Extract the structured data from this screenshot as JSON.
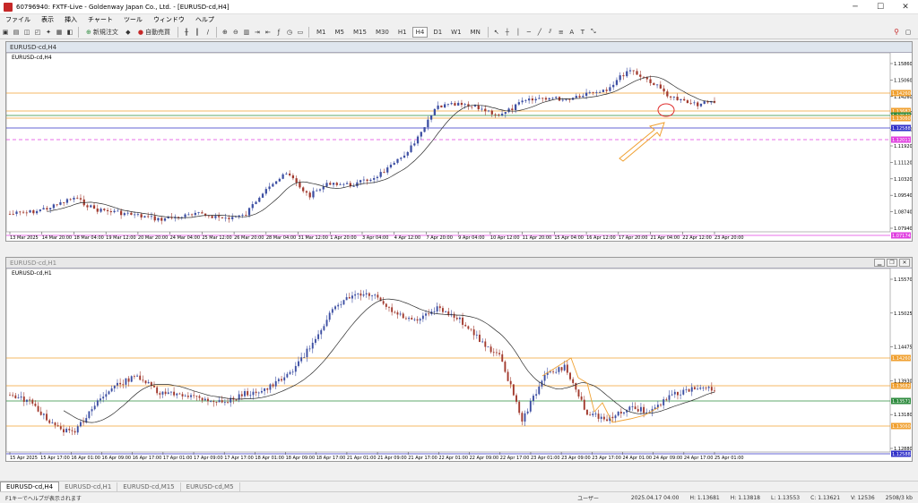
{
  "window": {
    "title": "60796940: FXTF-Live - Goldenway Japan Co., Ltd. - [EURUSD-cd,H4]"
  },
  "menu": [
    "ファイル",
    "表示",
    "挿入",
    "チャート",
    "ツール",
    "ウィンドウ",
    "ヘルプ"
  ],
  "toolbar": {
    "new_order": "新規注文",
    "auto_trade": "自動売買",
    "timeframes": [
      "M1",
      "M5",
      "M15",
      "M30",
      "H1",
      "H4",
      "D1",
      "W1",
      "MN"
    ]
  },
  "colors": {
    "bull": "#a23a2e",
    "bear": "#3d4fa3",
    "ma": "#2b2b2b",
    "orange": "#f0a030",
    "green": "#2e8b3e",
    "blue": "#3030c8",
    "magenta": "#e040e0"
  },
  "h4": {
    "window_title": "EURUSD-cd,H4",
    "label": "EURUSD-cd,H4",
    "yticks": [
      "1.15860",
      "1.15060",
      "1.14260",
      "1.13460",
      "1.12660",
      "1.11920",
      "1.11120",
      "1.10320",
      "1.09540",
      "1.08740",
      "1.07940"
    ],
    "price_tags": [
      {
        "text": "1.14260",
        "color": "#f0a030"
      },
      {
        "text": "1.13682",
        "color": "#f0a030"
      },
      {
        "text": "1.13571",
        "color": "#2e8b3e"
      },
      {
        "text": "1.13060",
        "color": "#f0a030"
      },
      {
        "text": "1.12588",
        "color": "#3030c8"
      },
      {
        "text": "1.12011",
        "color": "#e040e0"
      },
      {
        "text": "1.07174",
        "color": "#e040e0"
      }
    ],
    "xticks": [
      "13 Mar 2025",
      "14 Mar 20:00",
      "18 Mar 04:00",
      "19 Mar 12:00",
      "20 Mar 20:00",
      "24 Mar 04:00",
      "25 Mar 12:00",
      "26 Mar 20:00",
      "28 Mar 04:00",
      "31 Mar 12:00",
      "1 Apr 20:00",
      "3 Apr 04:00",
      "4 Apr 12:00",
      "7 Apr 20:00",
      "9 Apr 04:00",
      "10 Apr 12:00",
      "11 Apr 20:00",
      "15 Apr 04:00",
      "16 Apr 12:00",
      "17 Apr 20:00",
      "21 Apr 04:00",
      "22 Apr 12:00",
      "23 Apr 20:00"
    ]
  },
  "h1": {
    "window_title": "EURUSD-cd,H1",
    "label": "EURUSD-cd,H1",
    "yticks": [
      "1.15570",
      "1.15025",
      "1.14475",
      "1.13930",
      "1.13180",
      "1.12880"
    ],
    "price_tags": [
      {
        "text": "1.14260",
        "color": "#f0a030"
      },
      {
        "text": "1.13682",
        "color": "#f0a030"
      },
      {
        "text": "1.13571",
        "color": "#2e8b3e"
      },
      {
        "text": "1.13060",
        "color": "#f0a030"
      },
      {
        "text": "1.12588",
        "color": "#3030c8"
      }
    ],
    "xticks": [
      "15 Apr 2025",
      "15 Apr 17:00",
      "16 Apr 01:00",
      "16 Apr 09:00",
      "16 Apr 17:00",
      "17 Apr 01:00",
      "17 Apr 09:00",
      "17 Apr 17:00",
      "18 Apr 01:00",
      "18 Apr 09:00",
      "18 Apr 17:00",
      "21 Apr 01:00",
      "21 Apr 09:00",
      "21 Apr 17:00",
      "22 Apr 01:00",
      "22 Apr 09:00",
      "22 Apr 17:00",
      "23 Apr 01:00",
      "23 Apr 09:00",
      "23 Apr 17:00",
      "24 Apr 01:00",
      "24 Apr 09:00",
      "24 Apr 17:00",
      "25 Apr 01:00"
    ]
  },
  "tabs": [
    "EURUSD-cd,H4",
    "EURUSD-cd,H1",
    "EURUSD-cd,M15",
    "EURUSD-cd,M5"
  ],
  "status": {
    "help": "F1キーでヘルプが表示されます",
    "profile": "ユーザー",
    "datetime": "2025.04.17 04:00",
    "open": "H: 1.13681",
    "high": "H: 1.13818",
    "low": "L: 1.13553",
    "close": "C: 1.13621",
    "volume": "V: 12536",
    "traffic": "2508/3 kb"
  }
}
